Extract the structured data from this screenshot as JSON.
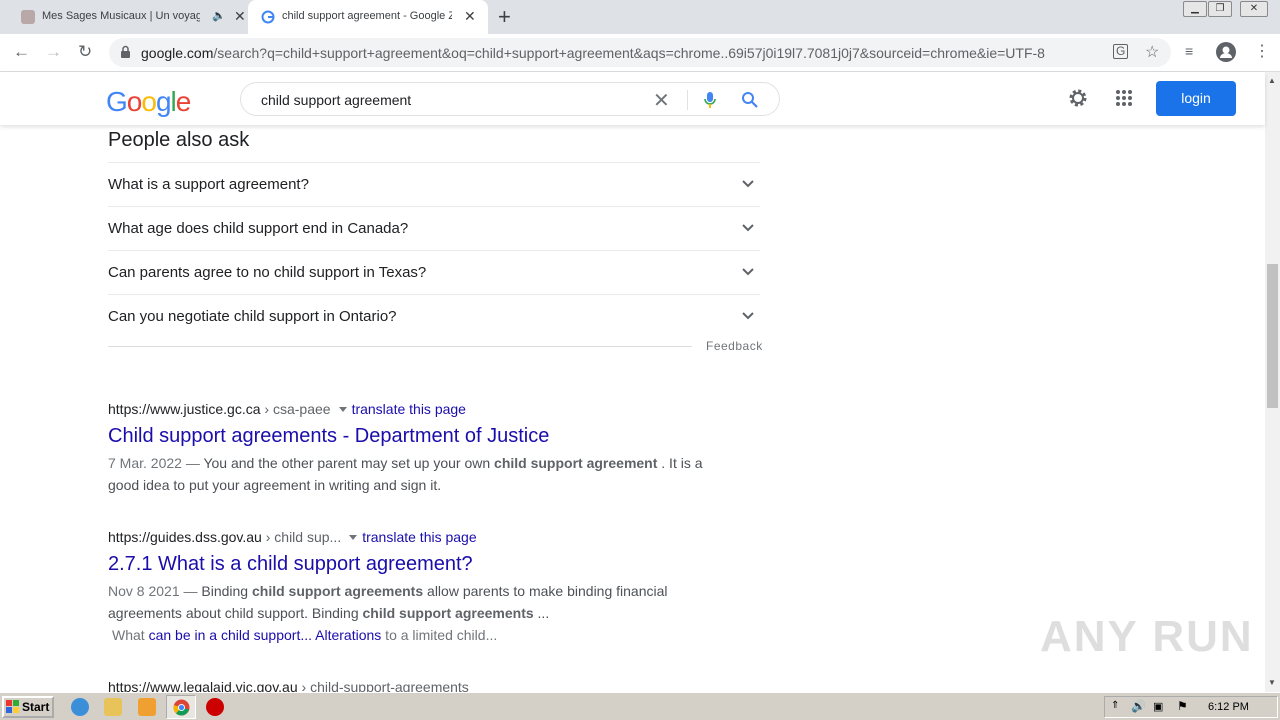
{
  "browser": {
    "tabs": [
      {
        "title": "Mes Sages Musicaux | Un voyag",
        "active": false
      },
      {
        "title": "child support agreement - Google Zo",
        "active": true
      }
    ],
    "url_host": "google.com",
    "url_rest": "/search?q=child+support+agreement&oq=child+support+agreement&aqs=chrome..69i57j0i19l7.7081j0j7&sourceid=chrome&ie=UTF-8"
  },
  "google": {
    "logo_letters": [
      {
        "ch": "G",
        "color": "#4285f4"
      },
      {
        "ch": "o",
        "color": "#ea4335"
      },
      {
        "ch": "o",
        "color": "#fbbc05"
      },
      {
        "ch": "g",
        "color": "#4285f4"
      },
      {
        "ch": "l",
        "color": "#34a853"
      },
      {
        "ch": "e",
        "color": "#ea4335"
      }
    ],
    "query": "child support agreement",
    "login_label": "login"
  },
  "paa": {
    "title": "People also ask",
    "questions": [
      "What is a support agreement?",
      "What age does child support end in Canada?",
      "Can parents agree to no child support in Texas?",
      "Can you negotiate child support in Ontario?"
    ],
    "feedback": "Feedback"
  },
  "results": [
    {
      "site": "https://www.justice.gc.ca",
      "path": "› csa-paee",
      "translate": "translate this page",
      "title": "Child support agreements - Department of Justice",
      "date": "7 Mar. 2022 —",
      "snippet_a": " You and the other parent may set up your own ",
      "snippet_b": "child support agreement",
      "snippet_c": " . It is a good idea to put your agreement in writing and sign it."
    },
    {
      "site": "https://guides.dss.gov.au",
      "path": "› child sup...",
      "translate": "translate this page",
      "title": "2.7.1 What is a child support agreement?",
      "date": "Nov 8 2021 —",
      "snippet_a": " Binding ",
      "snippet_b": "child support agreements",
      "snippet_c": " allow parents to make binding financial agreements about child support. Binding ",
      "snippet_d": "child support agreements",
      "snippet_e": "  ...",
      "links_prefix": "What ",
      "link1": "can be in a child support...",
      "link2": "Alterations",
      "links_suffix": " to a limited child..."
    },
    {
      "site": "https://www.legalaid.vic.gov.au",
      "path": "› child-support-agreements"
    }
  ],
  "taskbar": {
    "start_label": "Start",
    "clock": "6:12 PM"
  },
  "watermark": "ANY RUN"
}
